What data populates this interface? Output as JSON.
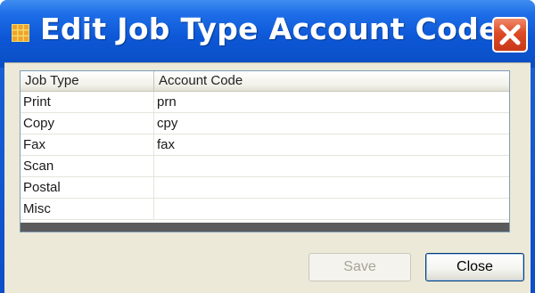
{
  "window": {
    "title": "Edit Job Type Account Codes"
  },
  "icons": {
    "app": "grid-app-icon",
    "close": "close-icon"
  },
  "grid": {
    "columns": [
      "Job Type",
      "Account Code"
    ],
    "rows": [
      {
        "job_type": "Print",
        "account_code": "prn"
      },
      {
        "job_type": "Copy",
        "account_code": "cpy"
      },
      {
        "job_type": "Fax",
        "account_code": "fax"
      },
      {
        "job_type": "Scan",
        "account_code": ""
      },
      {
        "job_type": "Postal",
        "account_code": ""
      },
      {
        "job_type": "Misc",
        "account_code": ""
      }
    ]
  },
  "buttons": {
    "save_label": "Save",
    "close_label": "Close"
  },
  "colors": {
    "titlebar": "#0d57d6",
    "close_button": "#dd4a26",
    "client_bg": "#ece9d8"
  }
}
